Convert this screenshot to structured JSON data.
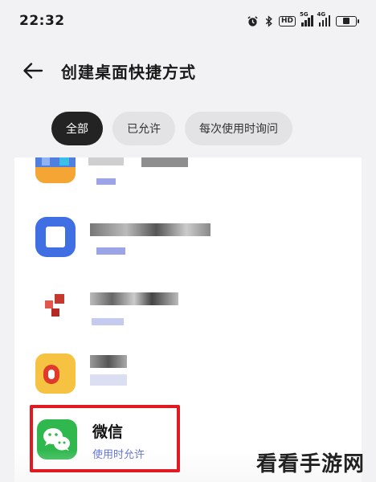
{
  "status_bar": {
    "time": "22:32",
    "icons": [
      "alarm-icon",
      "bluetooth-icon",
      "hd-icon",
      "5g-signal-icon",
      "4g-signal-icon",
      "battery-icon"
    ],
    "hd_label": "HD",
    "signal1_tag": "5G",
    "signal2_tag": "4G",
    "battery_level": 0.35
  },
  "header": {
    "title": "创建桌面快捷方式",
    "back_icon": "back-arrow-icon"
  },
  "filters": [
    {
      "label": "全部",
      "active": true
    },
    {
      "label": "已允许",
      "active": false
    },
    {
      "label": "每次使用时询问",
      "active": false
    }
  ],
  "apps": {
    "blurred_count": 4,
    "wechat": {
      "name": "微信",
      "status": "使用时允许",
      "icon": "wechat-icon",
      "icon_color": "#2fb84d"
    }
  },
  "watermark": "看看手游网",
  "colors": {
    "accent_blue": "#5b6fd6",
    "highlight_red": "#e11a22",
    "chip_active": "#232323"
  }
}
